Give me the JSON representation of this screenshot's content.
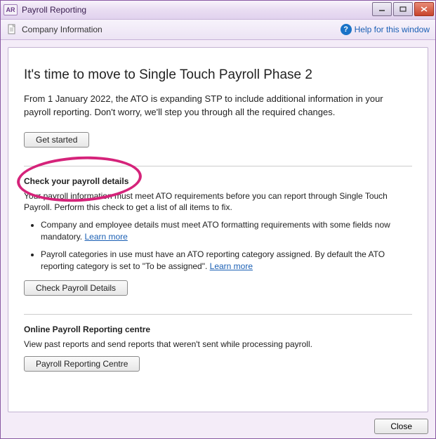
{
  "titlebar": {
    "app_badge": "AR",
    "title": "Payroll Reporting"
  },
  "toolbar": {
    "company_info_label": "Company Information",
    "help_label": "Help for this window"
  },
  "main": {
    "headline": "It's time to move to Single Touch Payroll Phase 2",
    "intro": "From 1 January 2022, the ATO is expanding STP to include additional information in your payroll reporting. Don't worry, we'll step you through all the required changes.",
    "get_started_label": "Get started",
    "section1": {
      "title": "Check your payroll details",
      "text": "Your payroll information must meet ATO requirements before you can report through Single Touch Payroll. Perform this check to get a list of all items to fix.",
      "bullet1_text": "Company and employee details must meet ATO formatting requirements with some fields now mandatory. ",
      "bullet2_text": "Payroll categories in use must have an ATO reporting category assigned. By default the ATO reporting category is set to \"To be assigned\". ",
      "learn_more": "Learn more",
      "button_label": "Check Payroll Details"
    },
    "section2": {
      "title": "Online Payroll Reporting centre",
      "text": "View past reports and send reports that weren't sent while processing payroll.",
      "button_label": "Payroll Reporting Centre"
    }
  },
  "footer": {
    "close_label": "Close"
  }
}
